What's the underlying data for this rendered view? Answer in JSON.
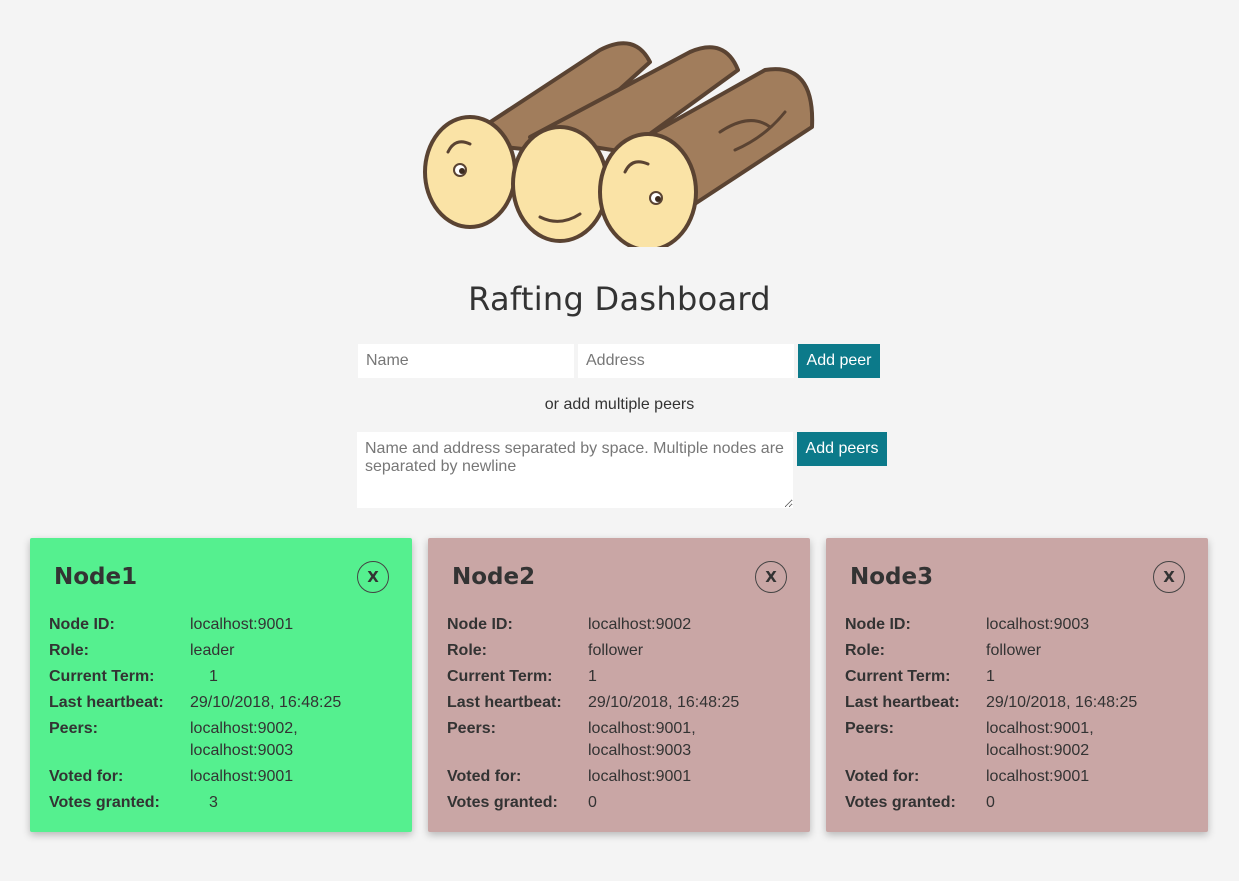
{
  "page": {
    "title": "Rafting Dashboard"
  },
  "single_peer": {
    "name_placeholder": "Name",
    "address_placeholder": "Address",
    "add_label": "Add peer"
  },
  "multi_peer": {
    "or_text": "or add multiple peers",
    "placeholder": "Name and address separated by space. Multiple nodes are separated by newline",
    "add_label": "Add peers"
  },
  "labels": {
    "node_id": "Node ID:",
    "role": "Role:",
    "current_term": "Current Term:",
    "last_heartbeat": "Last heartbeat:",
    "peers": "Peers:",
    "voted_for": "Voted for:",
    "votes_granted": "Votes granted:"
  },
  "colors": {
    "leader_card": "#55f08f",
    "follower_card": "#c9a6a5",
    "button": "#0c7a8a"
  },
  "nodes": [
    {
      "title": "Node1",
      "close_label": "X",
      "node_id": "localhost:9001",
      "role": "leader",
      "current_term": "1",
      "last_heartbeat": "29/10/2018, 16:48:25",
      "peers_line1": "localhost:9002,",
      "peers_line2": "localhost:9003",
      "voted_for": "localhost:9001",
      "votes_granted": "3"
    },
    {
      "title": "Node2",
      "close_label": "X",
      "node_id": "localhost:9002",
      "role": "follower",
      "current_term": "1",
      "last_heartbeat": "29/10/2018, 16:48:25",
      "peers_line1": "localhost:9001,",
      "peers_line2": "localhost:9003",
      "voted_for": "localhost:9001",
      "votes_granted": "0"
    },
    {
      "title": "Node3",
      "close_label": "X",
      "node_id": "localhost:9003",
      "role": "follower",
      "current_term": "1",
      "last_heartbeat": "29/10/2018, 16:48:25",
      "peers_line1": "localhost:9001,",
      "peers_line2": "localhost:9002",
      "voted_for": "localhost:9001",
      "votes_granted": "0"
    }
  ]
}
